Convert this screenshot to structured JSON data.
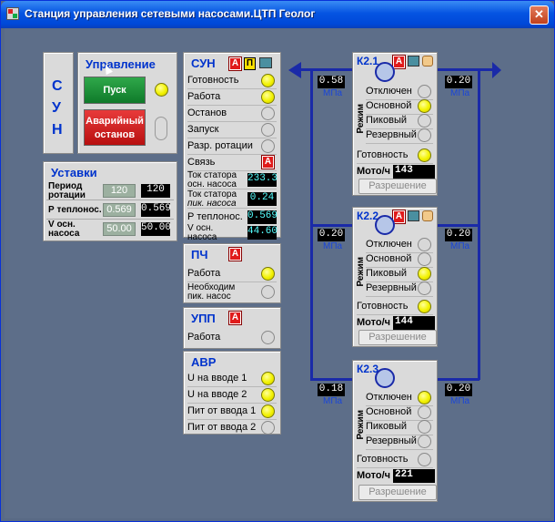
{
  "window": {
    "title": "Станция управления сетевыми насосами.ЦТП Геолог",
    "close_label": "✕"
  },
  "sun_side": {
    "letters": [
      "С",
      "У",
      "Н"
    ]
  },
  "control": {
    "title": "Управление",
    "start_label": "Пуск",
    "estop_label_1": "Аварийный",
    "estop_label_2": "останов"
  },
  "setpoints": {
    "title": "Уставки",
    "rows": [
      {
        "label_1": "Период",
        "label_2": "ротации",
        "set": "120",
        "actual": "120"
      },
      {
        "label_1": "Р теплонос.",
        "label_2": "",
        "set": "0.569",
        "actual": "0.569"
      },
      {
        "label_1": "V осн.",
        "label_2": "насоса",
        "set": "50.00",
        "actual": "50.00"
      }
    ]
  },
  "sun_status": {
    "title": "СУН",
    "badges": [
      "А",
      "П"
    ],
    "readiness": "Готовность",
    "work": "Работа",
    "stop": "Останов",
    "launch": "Запуск",
    "rot_allowed": "Разр. ротации",
    "link": "Связь",
    "link_badge": "А",
    "stator_main_1": "Ток статора",
    "stator_main_2": "осн. насоса",
    "stator_main_val": "233.3",
    "stator_peak_1": "Ток статора",
    "stator_peak_2": "пик. насоса",
    "stator_peak_val": "0.24",
    "p_carrier": "Р теплонос.",
    "p_carrier_val": "0.569",
    "v_main_1": "V осн.",
    "v_main_2": "насоса",
    "v_main_val": "44.60"
  },
  "pch": {
    "title": "ПЧ",
    "badge": "А",
    "work": "Работа",
    "need_1": "Необходим",
    "need_2": "пик. насос"
  },
  "upp": {
    "title": "УПП",
    "badge": "А",
    "work": "Работа"
  },
  "avr": {
    "title": "АВР",
    "items": [
      "U  на вводе 1",
      "U  на вводе 2",
      "Пит от ввода 1",
      "Пит от ввода 2"
    ]
  },
  "pumps": [
    {
      "name": "К2.1",
      "p_in": "0.58",
      "p_out": "0.20",
      "unit": "МПа",
      "off": "Отключен",
      "main": "Основной",
      "peak": "Пиковый",
      "reserve": "Резервный",
      "mode_label": "Режим",
      "ready": "Готовность",
      "motoh_label": "Мото/ч",
      "motoh": "143",
      "permit": "Разрешение"
    },
    {
      "name": "К2.2",
      "p_in": "0.20",
      "p_out": "0.20",
      "unit": "МПа",
      "off": "Отключен",
      "main": "Основной",
      "peak": "Пиковый",
      "reserve": "Резервный",
      "mode_label": "Режим",
      "ready": "Готовность",
      "motoh_label": "Мото/ч",
      "motoh": "144",
      "permit": "Разрешение"
    },
    {
      "name": "К2.3",
      "p_in": "0.18",
      "p_out": "0.20",
      "unit": "МПа",
      "off": "Отключен",
      "main": "Основной",
      "peak": "Пиковый",
      "reserve": "Резервный",
      "mode_label": "Режим",
      "ready": "Готовность",
      "motoh_label": "Мото/ч",
      "motoh": "221",
      "permit": "Разрешение"
    }
  ]
}
